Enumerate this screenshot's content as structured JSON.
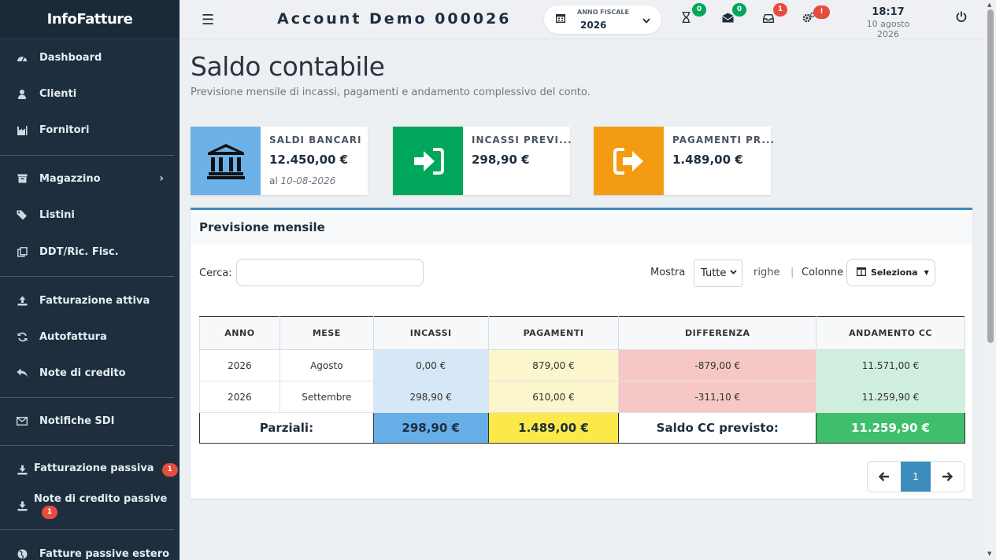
{
  "app": {
    "brand": "InfoFatture"
  },
  "sidebar": {
    "items": [
      {
        "label": "Dashboard",
        "icon": "dashboard-icon"
      },
      {
        "label": "Clienti",
        "icon": "user-icon"
      },
      {
        "label": "Fornitori",
        "icon": "industry-icon"
      },
      {
        "label": "Magazzino",
        "icon": "archive-icon",
        "chevron": "›"
      },
      {
        "label": "Listini",
        "icon": "tags-icon"
      },
      {
        "label": "DDT/Ric. Fisc.",
        "icon": "copy-icon"
      },
      {
        "label": "Fatturazione attiva",
        "icon": "upload-icon"
      },
      {
        "label": "Autofattura",
        "icon": "refresh-icon"
      },
      {
        "label": "Note di credito",
        "icon": "reply-icon"
      },
      {
        "label": "Notifiche SDI",
        "icon": "envelope-icon"
      },
      {
        "label": "Fatturazione passiva",
        "icon": "download-icon",
        "badge": "1"
      },
      {
        "label": "Note di credito passive",
        "icon": "download-icon",
        "badge": "1"
      },
      {
        "label": "Fatture passive estero",
        "icon": "globe-icon"
      }
    ]
  },
  "topbar": {
    "account": "Account Demo 000026",
    "fiscal_year_label": "ANNO FISCALE",
    "fiscal_year": "2026",
    "badges": {
      "hourglass": "0",
      "mail": "0",
      "inbox": "1",
      "settings": "!"
    },
    "time": "18:17",
    "date": "10 agosto 2026"
  },
  "page": {
    "title": "Saldo contabile",
    "subtitle": "Previsione mensile di incassi, pagamenti e andamento complessivo del conto."
  },
  "cards": [
    {
      "title": "SALDI BANCARI",
      "value": "12.450,00 €",
      "date_prefix": "al",
      "date": "10-08-2026",
      "color": "#6cb2e8"
    },
    {
      "title": "INCASSI PREVI...",
      "value": "298,90 €",
      "color": "#00a65a"
    },
    {
      "title": "PAGAMENTI PR...",
      "value": "1.489,00 €",
      "color": "#f39c12"
    }
  ],
  "panel": {
    "title": "Previsione mensile",
    "search_label": "Cerca:",
    "search_value": "",
    "show_label": "Mostra",
    "show_value": "Tutte",
    "rows_label": "righe",
    "columns_label": "Colonne",
    "columns_button": "Seleziona"
  },
  "table": {
    "headers": [
      "ANNO",
      "MESE",
      "INCASSI",
      "PAGAMENTI",
      "DIFFERENZA",
      "ANDAMENTO CC"
    ],
    "rows": [
      [
        "2026",
        "Agosto",
        "0,00 €",
        "879,00 €",
        "-879,00 €",
        "11.571,00 €"
      ],
      [
        "2026",
        "Settembre",
        "298,90 €",
        "610,00 €",
        "-311,10 €",
        "11.259,90 €"
      ]
    ],
    "footer": {
      "label": "Parziali:",
      "incassi": "298,90 €",
      "pagamenti": "1.489,00 €",
      "saldo_label": "Saldo CC previsto:",
      "saldo": "11.259,90 €"
    }
  },
  "pagination": {
    "current": "1",
    "prev": "🡐",
    "next": "🡒"
  }
}
